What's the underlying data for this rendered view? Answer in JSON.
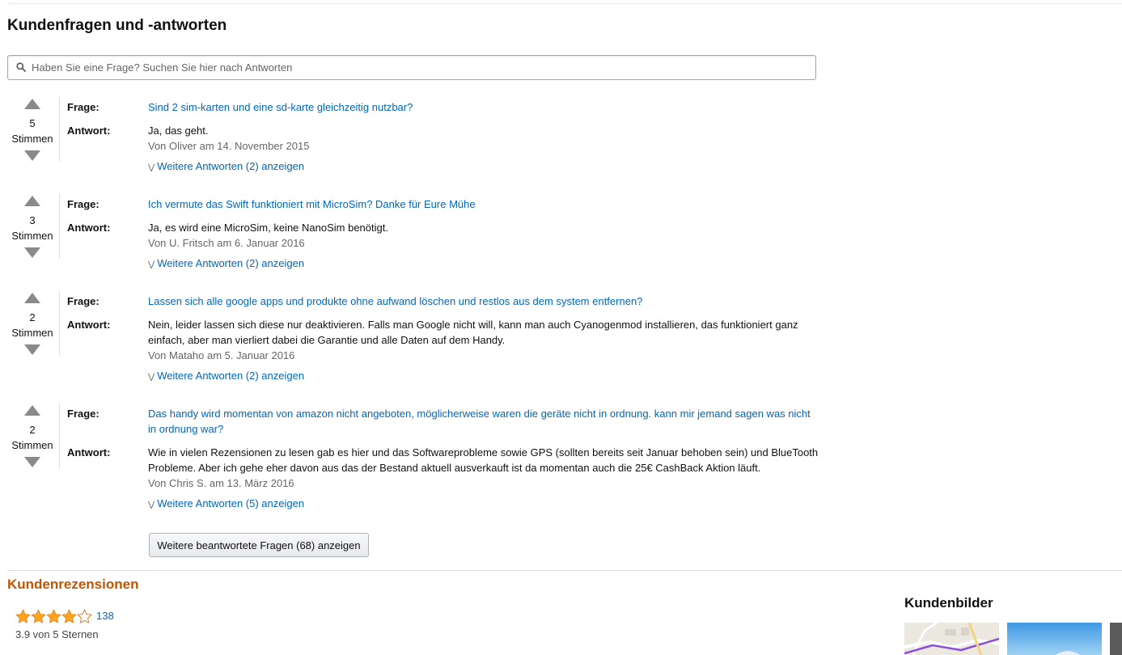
{
  "qa": {
    "title": "Kundenfragen und -antworten",
    "search_placeholder": "Haben Sie eine Frage? Suchen Sie hier nach Antworten",
    "question_label": "Frage:",
    "answer_label": "Antwort:",
    "votes_label": "Stimmen",
    "items": [
      {
        "votes": "5",
        "question": "Sind 2 sim-karten und eine sd-karte gleichzeitig nutzbar?",
        "answer": "Ja, das geht.",
        "meta": "Von Oliver am 14. November 2015",
        "more": "Weitere Antworten (2) anzeigen"
      },
      {
        "votes": "3",
        "question": "Ich vermute das Swift funktioniert mit MicroSim? Danke für Eure Mühe",
        "answer": "Ja, es wird eine MicroSim, keine NanoSim benötigt.",
        "meta": "Von U. Fritsch am 6. Januar 2016",
        "more": "Weitere Antworten (2) anzeigen"
      },
      {
        "votes": "2",
        "question": "Lassen sich alle google apps und produkte ohne aufwand löschen und restlos aus dem system entfernen?",
        "answer": "Nein, leider lassen sich diese nur deaktivieren. Falls man Google nicht will, kann man auch Cyanogenmod installieren, das funktioniert ganz einfach, aber man vierliert dabei die Garantie und alle Daten auf dem Handy.",
        "meta": "Von Mataho am 5. Januar 2016",
        "more": "Weitere Antworten (2) anzeigen"
      },
      {
        "votes": "2",
        "question": "Das handy wird momentan von amazon nicht angeboten, möglicherweise waren die geräte nicht in ordnung. kann mir jemand sagen was nicht in ordnung war?",
        "answer": "Wie in vielen Rezensionen zu lesen gab es hier und das Softwareprobleme sowie GPS (sollten bereits seit Januar behoben sein) und BlueTooth Probleme. Aber ich gehe eher davon aus das der Bestand aktuell ausverkauft ist da momentan auch die 25€ CashBack Aktion läuft.",
        "meta": "Von Chris S. am 13. März 2016",
        "more": "Weitere Antworten (5) anzeigen"
      }
    ],
    "more_questions_button": "Weitere beantwortete Fragen (68) anzeigen"
  },
  "reviews": {
    "title": "Kundenrezensionen",
    "rating": 3.9,
    "stars_filled": 4,
    "stars_total": 5,
    "count": "138",
    "average_text": "3.9 von 5 Sternen"
  },
  "customer_images": {
    "title": "Kundenbilder"
  },
  "colors": {
    "link": "#0066c0",
    "reviews_heading": "#c45500",
    "star": "#ffa41c"
  }
}
